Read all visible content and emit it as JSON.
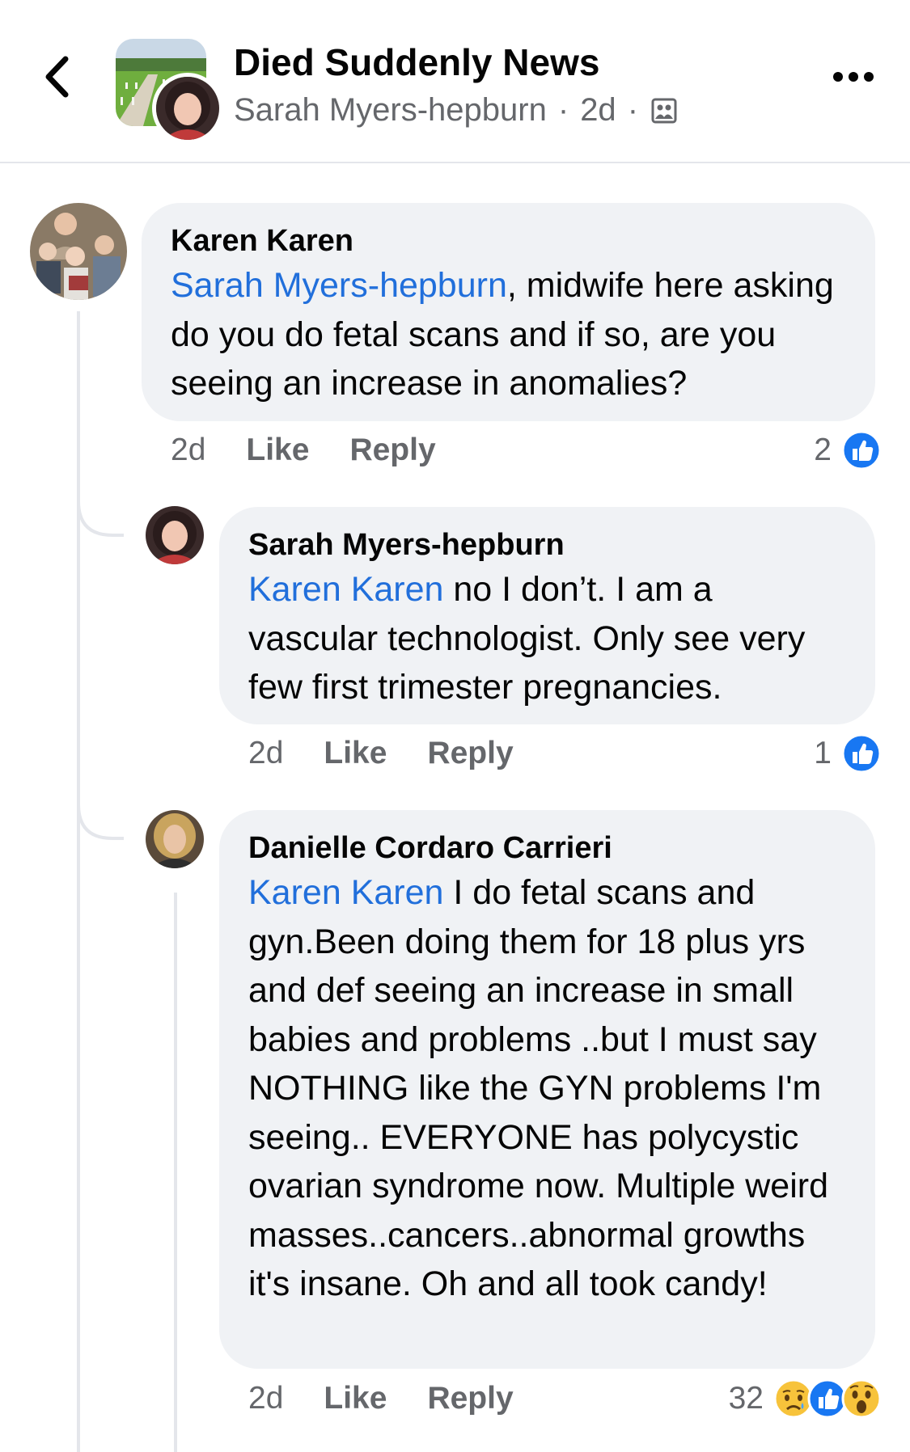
{
  "header": {
    "title": "Died Suddenly News",
    "author": "Sarah Myers-hepburn",
    "separator": "·",
    "time": "2d",
    "privacy_icon": "group-privacy-icon",
    "back_icon": "chevron-left-icon",
    "more_icon": "more-horizontal-icon"
  },
  "comments": [
    {
      "author": "Karen Karen",
      "mention": "Sarah Myers-hepburn",
      "text_after_mention": ", midwife here asking do you do fetal scans and if so, are you seeing an increase in anomalies?",
      "time": "2d",
      "like_label": "Like",
      "reply_label": "Reply",
      "reaction_count": "2",
      "reactions": [
        "like"
      ]
    },
    {
      "author": "Sarah Myers-hepburn",
      "mention": "Karen Karen",
      "text_after_mention": " no I don’t. I am a vascular technologist. Only see very few first trimester pregnancies.",
      "time": "2d",
      "like_label": "Like",
      "reply_label": "Reply",
      "reaction_count": "1",
      "reactions": [
        "like"
      ]
    },
    {
      "author": "Danielle Cordaro Carrieri",
      "mention": "Karen Karen",
      "text_after_mention": " I do fetal scans and gyn.Been doing them for 18 plus yrs and def seeing an increase in small babies and problems ..but I must say NOTHING like the GYN problems I'm seeing.. EVERYONE has polycystic ovarian syndrome now. Multiple weird masses..cancers..abnormal growths it's insane. Oh and all took candy!",
      "time": "2d",
      "like_label": "Like",
      "reply_label": "Reply",
      "reaction_count": "32",
      "reactions": [
        "sad",
        "like",
        "wow"
      ]
    }
  ],
  "colors": {
    "mention": "#216fdb",
    "bubble": "#f0f2f5",
    "meta_text": "#65676b",
    "like_blue": "#1877f2",
    "thread_line": "#e4e6eb"
  }
}
